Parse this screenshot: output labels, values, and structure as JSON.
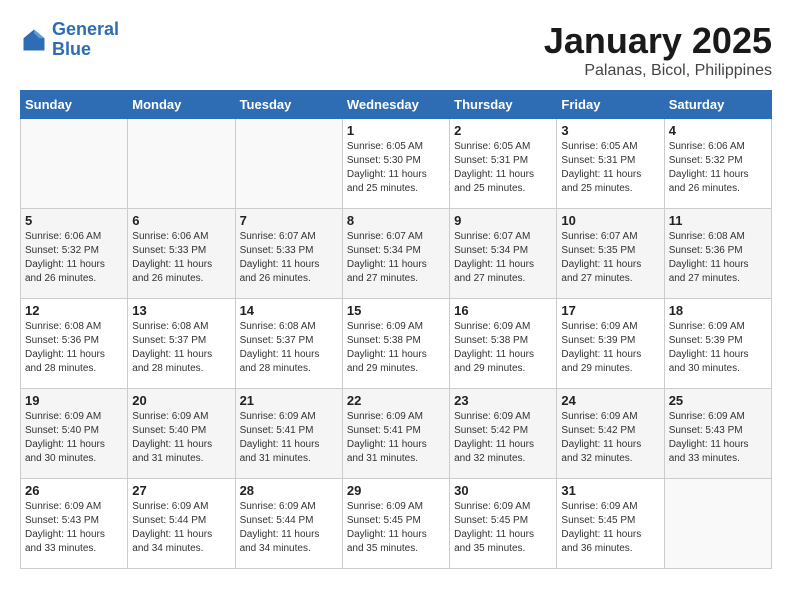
{
  "header": {
    "logo_line1": "General",
    "logo_line2": "Blue",
    "title": "January 2025",
    "subtitle": "Palanas, Bicol, Philippines"
  },
  "days_of_week": [
    "Sunday",
    "Monday",
    "Tuesday",
    "Wednesday",
    "Thursday",
    "Friday",
    "Saturday"
  ],
  "weeks": [
    [
      {
        "day": "",
        "info": ""
      },
      {
        "day": "",
        "info": ""
      },
      {
        "day": "",
        "info": ""
      },
      {
        "day": "1",
        "info": "Sunrise: 6:05 AM\nSunset: 5:30 PM\nDaylight: 11 hours\nand 25 minutes."
      },
      {
        "day": "2",
        "info": "Sunrise: 6:05 AM\nSunset: 5:31 PM\nDaylight: 11 hours\nand 25 minutes."
      },
      {
        "day": "3",
        "info": "Sunrise: 6:05 AM\nSunset: 5:31 PM\nDaylight: 11 hours\nand 25 minutes."
      },
      {
        "day": "4",
        "info": "Sunrise: 6:06 AM\nSunset: 5:32 PM\nDaylight: 11 hours\nand 26 minutes."
      }
    ],
    [
      {
        "day": "5",
        "info": "Sunrise: 6:06 AM\nSunset: 5:32 PM\nDaylight: 11 hours\nand 26 minutes."
      },
      {
        "day": "6",
        "info": "Sunrise: 6:06 AM\nSunset: 5:33 PM\nDaylight: 11 hours\nand 26 minutes."
      },
      {
        "day": "7",
        "info": "Sunrise: 6:07 AM\nSunset: 5:33 PM\nDaylight: 11 hours\nand 26 minutes."
      },
      {
        "day": "8",
        "info": "Sunrise: 6:07 AM\nSunset: 5:34 PM\nDaylight: 11 hours\nand 27 minutes."
      },
      {
        "day": "9",
        "info": "Sunrise: 6:07 AM\nSunset: 5:34 PM\nDaylight: 11 hours\nand 27 minutes."
      },
      {
        "day": "10",
        "info": "Sunrise: 6:07 AM\nSunset: 5:35 PM\nDaylight: 11 hours\nand 27 minutes."
      },
      {
        "day": "11",
        "info": "Sunrise: 6:08 AM\nSunset: 5:36 PM\nDaylight: 11 hours\nand 27 minutes."
      }
    ],
    [
      {
        "day": "12",
        "info": "Sunrise: 6:08 AM\nSunset: 5:36 PM\nDaylight: 11 hours\nand 28 minutes."
      },
      {
        "day": "13",
        "info": "Sunrise: 6:08 AM\nSunset: 5:37 PM\nDaylight: 11 hours\nand 28 minutes."
      },
      {
        "day": "14",
        "info": "Sunrise: 6:08 AM\nSunset: 5:37 PM\nDaylight: 11 hours\nand 28 minutes."
      },
      {
        "day": "15",
        "info": "Sunrise: 6:09 AM\nSunset: 5:38 PM\nDaylight: 11 hours\nand 29 minutes."
      },
      {
        "day": "16",
        "info": "Sunrise: 6:09 AM\nSunset: 5:38 PM\nDaylight: 11 hours\nand 29 minutes."
      },
      {
        "day": "17",
        "info": "Sunrise: 6:09 AM\nSunset: 5:39 PM\nDaylight: 11 hours\nand 29 minutes."
      },
      {
        "day": "18",
        "info": "Sunrise: 6:09 AM\nSunset: 5:39 PM\nDaylight: 11 hours\nand 30 minutes."
      }
    ],
    [
      {
        "day": "19",
        "info": "Sunrise: 6:09 AM\nSunset: 5:40 PM\nDaylight: 11 hours\nand 30 minutes."
      },
      {
        "day": "20",
        "info": "Sunrise: 6:09 AM\nSunset: 5:40 PM\nDaylight: 11 hours\nand 31 minutes."
      },
      {
        "day": "21",
        "info": "Sunrise: 6:09 AM\nSunset: 5:41 PM\nDaylight: 11 hours\nand 31 minutes."
      },
      {
        "day": "22",
        "info": "Sunrise: 6:09 AM\nSunset: 5:41 PM\nDaylight: 11 hours\nand 31 minutes."
      },
      {
        "day": "23",
        "info": "Sunrise: 6:09 AM\nSunset: 5:42 PM\nDaylight: 11 hours\nand 32 minutes."
      },
      {
        "day": "24",
        "info": "Sunrise: 6:09 AM\nSunset: 5:42 PM\nDaylight: 11 hours\nand 32 minutes."
      },
      {
        "day": "25",
        "info": "Sunrise: 6:09 AM\nSunset: 5:43 PM\nDaylight: 11 hours\nand 33 minutes."
      }
    ],
    [
      {
        "day": "26",
        "info": "Sunrise: 6:09 AM\nSunset: 5:43 PM\nDaylight: 11 hours\nand 33 minutes."
      },
      {
        "day": "27",
        "info": "Sunrise: 6:09 AM\nSunset: 5:44 PM\nDaylight: 11 hours\nand 34 minutes."
      },
      {
        "day": "28",
        "info": "Sunrise: 6:09 AM\nSunset: 5:44 PM\nDaylight: 11 hours\nand 34 minutes."
      },
      {
        "day": "29",
        "info": "Sunrise: 6:09 AM\nSunset: 5:45 PM\nDaylight: 11 hours\nand 35 minutes."
      },
      {
        "day": "30",
        "info": "Sunrise: 6:09 AM\nSunset: 5:45 PM\nDaylight: 11 hours\nand 35 minutes."
      },
      {
        "day": "31",
        "info": "Sunrise: 6:09 AM\nSunset: 5:45 PM\nDaylight: 11 hours\nand 36 minutes."
      },
      {
        "day": "",
        "info": ""
      }
    ]
  ]
}
